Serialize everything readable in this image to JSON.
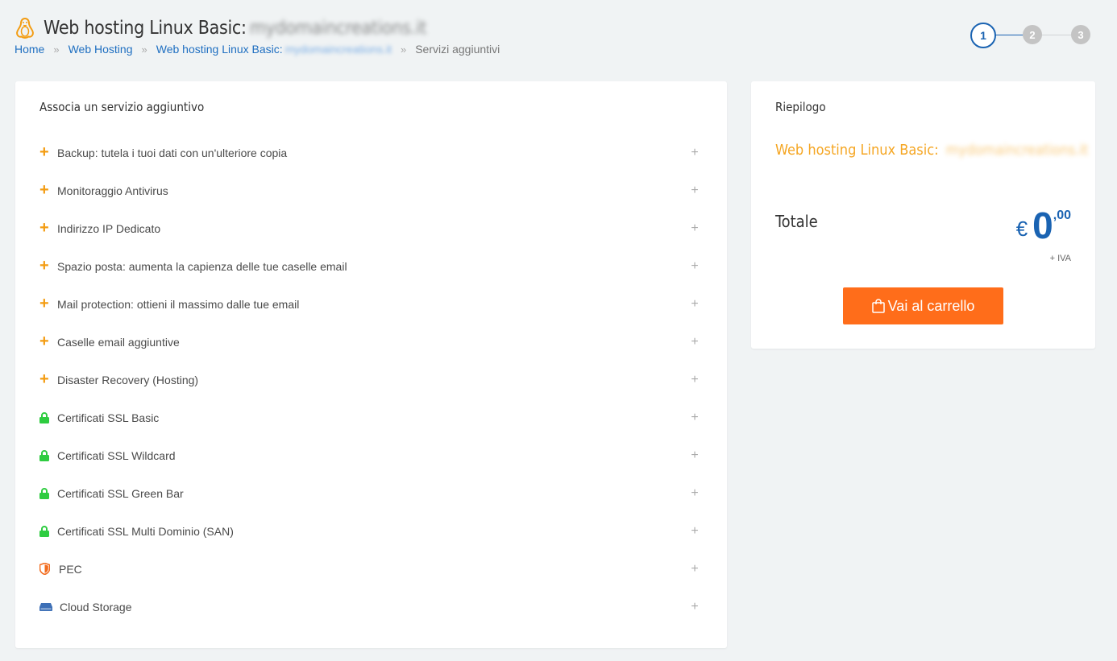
{
  "header": {
    "title": "Web hosting Linux Basic:",
    "title_domain_blurred": "mydomaincreations.it",
    "breadcrumb": {
      "home": "Home",
      "sep": "»",
      "web_hosting": "Web Hosting",
      "product": "Web hosting Linux Basic:",
      "product_domain_blurred": "mydomaincreations.it",
      "current": "Servizi aggiuntivi"
    }
  },
  "steps": [
    "1",
    "2",
    "3"
  ],
  "services_card": {
    "title": "Associa un servizio aggiuntivo",
    "expand_symbol": "+",
    "items": [
      {
        "label": "Backup: tutela i tuoi dati con un'ulteriore copia",
        "icon": "plus-icon"
      },
      {
        "label": "Monitoraggio Antivirus",
        "icon": "plus-icon"
      },
      {
        "label": "Indirizzo IP Dedicato",
        "icon": "plus-icon"
      },
      {
        "label": "Spazio posta: aumenta la capienza delle tue caselle email",
        "icon": "plus-icon"
      },
      {
        "label": "Mail protection: ottieni il massimo dalle tue email",
        "icon": "plus-icon"
      },
      {
        "label": "Caselle email aggiuntive",
        "icon": "plus-icon"
      },
      {
        "label": "Disaster Recovery (Hosting)",
        "icon": "plus-icon"
      },
      {
        "label": "Certificati SSL Basic",
        "icon": "lock-icon"
      },
      {
        "label": "Certificati SSL Wildcard",
        "icon": "lock-icon"
      },
      {
        "label": "Certificati SSL Green Bar",
        "icon": "lock-icon"
      },
      {
        "label": "Certificati SSL Multi Dominio (SAN)",
        "icon": "lock-icon"
      },
      {
        "label": "PEC",
        "icon": "shield-icon"
      },
      {
        "label": "Cloud Storage",
        "icon": "hard-drive-icon"
      }
    ]
  },
  "summary": {
    "title": "Riepilogo",
    "product": "Web hosting Linux Basic:",
    "product_domain_blurred": "mydomaincreations.it",
    "total_label": "Totale",
    "currency": "€",
    "price_int": "0",
    "price_dec": ",00",
    "vat_note": "+ IVA",
    "cart_button": "Vai al carrello"
  },
  "colors": {
    "accent_blue": "#1a63b2",
    "orange": "#f39c12",
    "cta_orange": "#ff6d1a",
    "lock_green": "#2ecc40",
    "shield_orange": "#f26b1d",
    "drive_blue": "#3d6fb6"
  }
}
